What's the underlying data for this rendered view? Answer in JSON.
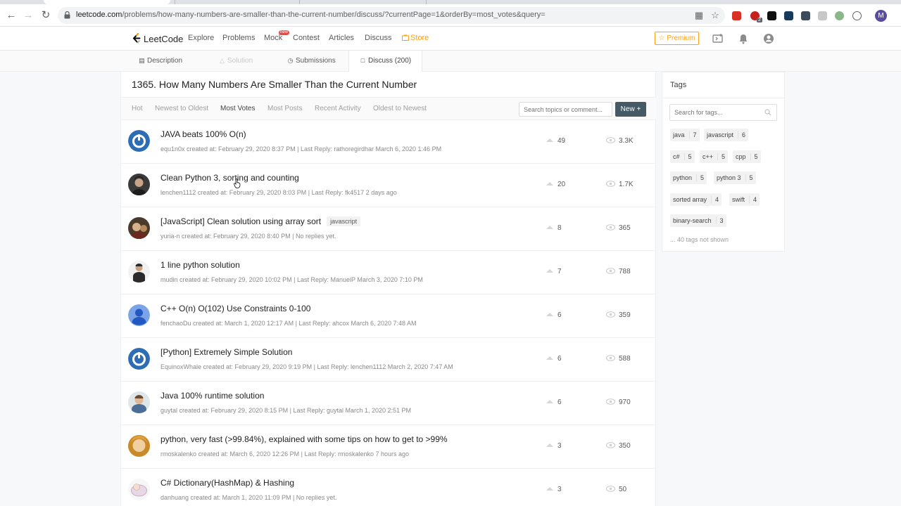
{
  "browser": {
    "url_host": "leetcode.com",
    "url_path": "/problems/how-many-numbers-are-smaller-than-the-current-number/discuss/?currentPage=1&orderBy=most_votes&query=",
    "profile_initial": "M",
    "extension_badge": "2"
  },
  "nav": {
    "logo": "LeetCode",
    "links": [
      "Explore",
      "Problems",
      "Mock",
      "Contest",
      "Articles",
      "Discuss",
      "Store"
    ],
    "mock_badge": "new",
    "premium": "Premium"
  },
  "problem_tabs": [
    {
      "label": "Description"
    },
    {
      "label": "Solution"
    },
    {
      "label": "Submissions"
    },
    {
      "label": "Discuss (200)"
    }
  ],
  "page_title": "1365. How Many Numbers Are Smaller Than the Current Number",
  "sort_options": [
    "Hot",
    "Newest to Oldest",
    "Most Votes",
    "Most Posts",
    "Recent Activity",
    "Oldest to Newest"
  ],
  "search_topics": {
    "placeholder": "Search topics or comment..."
  },
  "new_button": "New",
  "topics": [
    {
      "title": "JAVA beats 100% O(n)",
      "tag": "",
      "meta": "equ1n0x created at: February 29, 2020 8:37 PM | Last Reply: rathoregirdhar March 6, 2020 1:46 PM",
      "votes": "49",
      "views": "3.3K"
    },
    {
      "title": "Clean Python 3, sorting and counting",
      "tag": "",
      "meta": "lenchen1112 created at: February 29, 2020 8:03 PM | Last Reply: fk4517 2 days ago",
      "votes": "20",
      "views": "1.7K"
    },
    {
      "title": "[JavaScript] Clean solution using array sort",
      "tag": "javascript",
      "meta": "yuria-n created at: February 29, 2020 8:40 PM | No replies yet.",
      "votes": "8",
      "views": "365"
    },
    {
      "title": "1 line python solution",
      "tag": "",
      "meta": "mudin created at: February 29, 2020 10:02 PM | Last Reply: ManuelP March 3, 2020 7:10 PM",
      "votes": "7",
      "views": "788"
    },
    {
      "title": "C++ O(n) O(102) Use Constraints 0-100",
      "tag": "",
      "meta": "fenchaoDu created at: March 1, 2020 12:17 AM | Last Reply: ahcox March 6, 2020 7:48 AM",
      "votes": "6",
      "views": "359"
    },
    {
      "title": "[Python] Extremely Simple Solution",
      "tag": "",
      "meta": "EquinoxWhale created at: February 29, 2020 9:19 PM | Last Reply: lenchen1112 March 2, 2020 7:47 AM",
      "votes": "6",
      "views": "588"
    },
    {
      "title": "Java 100% runtime solution",
      "tag": "",
      "meta": "guytal created at: February 29, 2020 8:15 PM | Last Reply: guytal March 1, 2020 2:51 PM",
      "votes": "6",
      "views": "970"
    },
    {
      "title": "python, very fast (>99.84%), explained with some tips on how to get to >99%",
      "tag": "",
      "meta": "rmoskalenko created at: March 6, 2020 12:26 PM | Last Reply: rmoskalenko 7 hours ago",
      "votes": "3",
      "views": "350"
    },
    {
      "title": "C# Dictionary(HashMap) & Hashing",
      "tag": "",
      "meta": "danhuang created at: March 1, 2020 11:09 PM | No replies yet.",
      "votes": "3",
      "views": "50"
    }
  ],
  "tags_panel": {
    "title": "Tags",
    "search_placeholder": "Search for tags...",
    "tags": [
      {
        "name": "java",
        "count": "7"
      },
      {
        "name": "javascript",
        "count": "6"
      },
      {
        "name": "c#",
        "count": "5"
      },
      {
        "name": "c++",
        "count": "5"
      },
      {
        "name": "cpp",
        "count": "5"
      },
      {
        "name": "python",
        "count": "5"
      },
      {
        "name": "python 3",
        "count": "5"
      },
      {
        "name": "sorted array",
        "count": "4"
      },
      {
        "name": "swift",
        "count": "4"
      },
      {
        "name": "binary-search",
        "count": "3"
      }
    ],
    "more": "... 40 tags not shown"
  },
  "colors": {
    "accent": "#ffa116",
    "new_button": "#455a64",
    "badge": "#ef4743"
  }
}
